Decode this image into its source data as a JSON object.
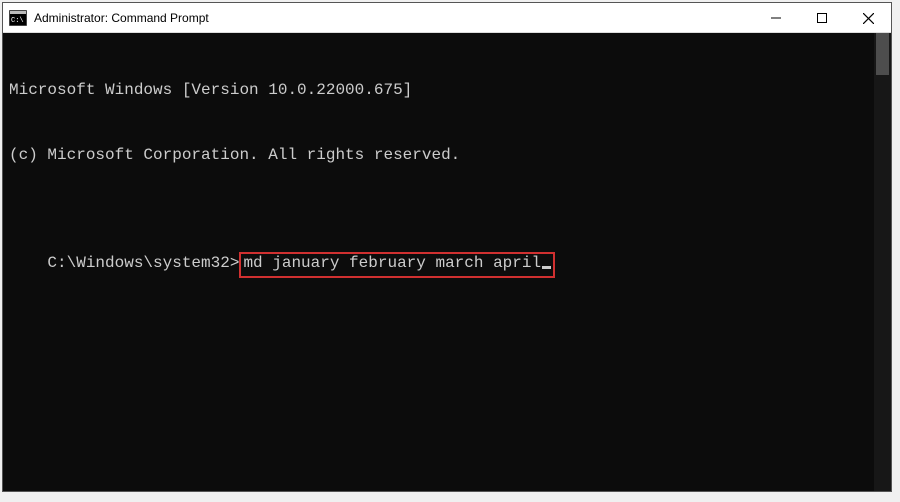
{
  "titlebar": {
    "title": "Administrator: Command Prompt"
  },
  "terminal": {
    "line1": "Microsoft Windows [Version 10.0.22000.675]",
    "line2": "(c) Microsoft Corporation. All rights reserved.",
    "prompt": "C:\\Windows\\system32>",
    "command": "md january february march april"
  }
}
